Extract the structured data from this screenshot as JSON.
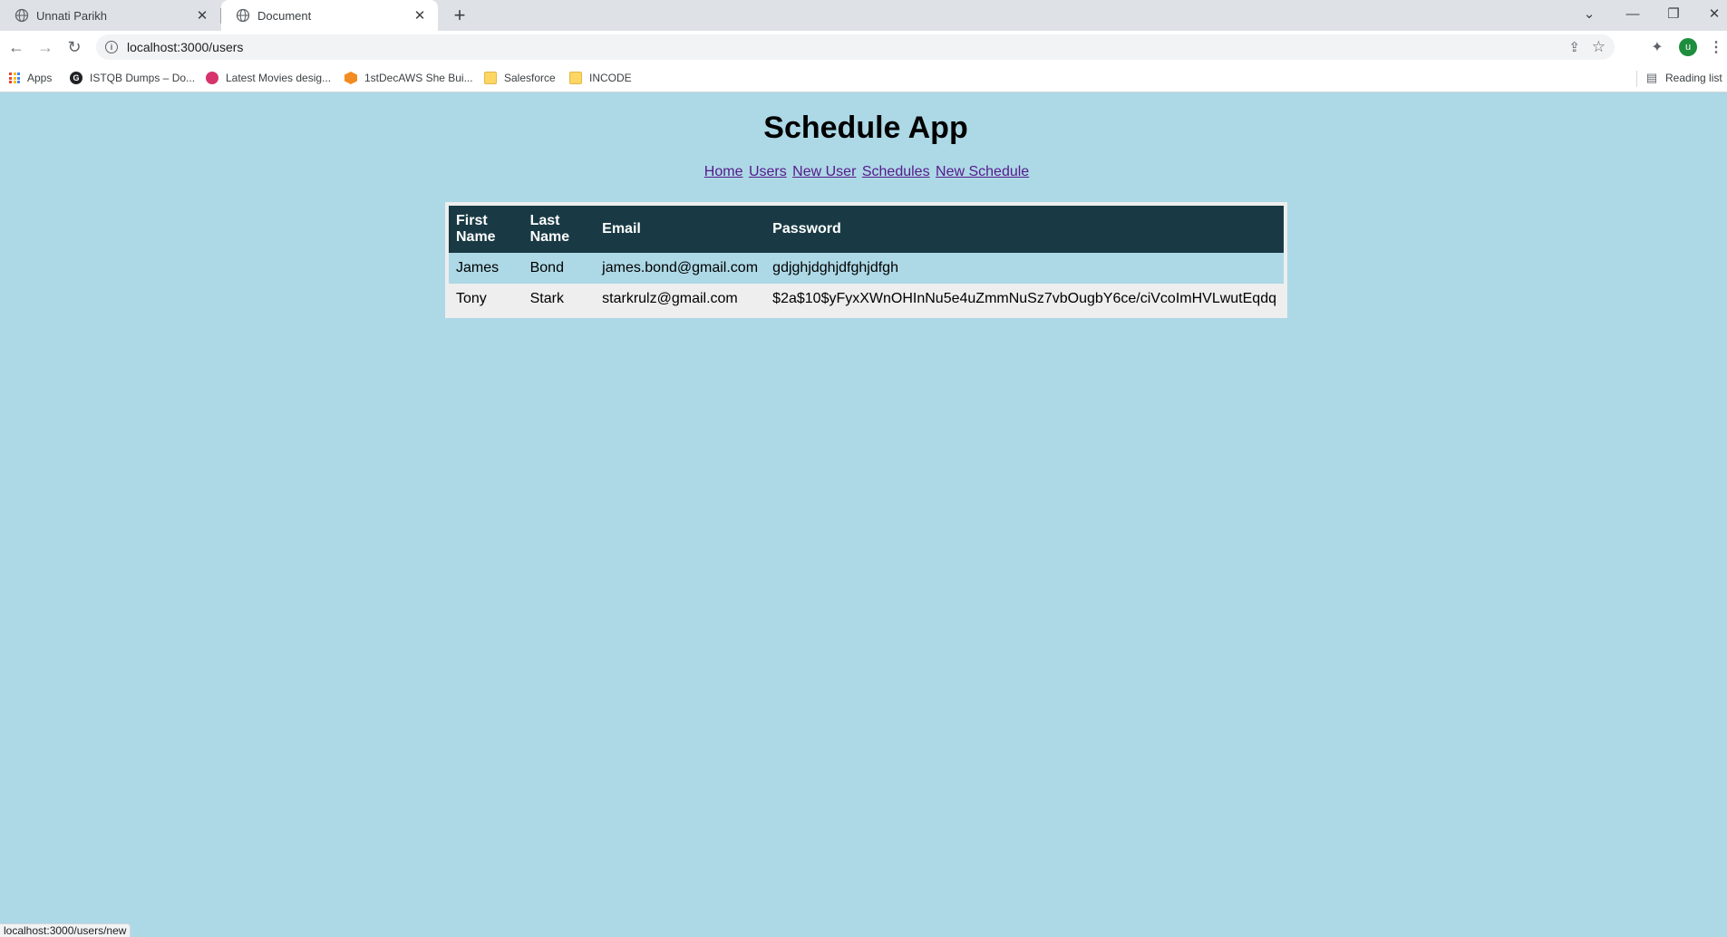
{
  "browser": {
    "tabs": [
      {
        "title": "Unnati Parikh",
        "active": false
      },
      {
        "title": "Document",
        "active": true
      }
    ],
    "new_tab_label": "+",
    "url": "localhost:3000/users",
    "bookmarks": [
      {
        "label": "Apps",
        "icon": "apps-grid-icon"
      },
      {
        "label": "ISTQB Dumps – Do...",
        "icon": "g-logo-icon"
      },
      {
        "label": "Latest Movies desig...",
        "icon": "dribbble-icon"
      },
      {
        "label": "1stDecAWS She Bui...",
        "icon": "aws-cube-icon"
      },
      {
        "label": "Salesforce",
        "icon": "folder-icon"
      },
      {
        "label": "INCODE",
        "icon": "folder-icon"
      }
    ],
    "reading_list_label": "Reading list",
    "avatar_initial": "u",
    "status_url": "localhost:3000/users/new"
  },
  "page": {
    "title": "Schedule App",
    "nav": [
      "Home",
      "Users",
      "New User",
      "Schedules",
      "New Schedule"
    ]
  },
  "users_table": {
    "headers": {
      "first_name": "First Name",
      "last_name": "Last Name",
      "email": "Email",
      "password": "Password"
    },
    "rows": [
      {
        "first_name": "James",
        "last_name": "Bond",
        "email": "james.bond@gmail.com",
        "password": "gdjghjdghjdfghjdfgh"
      },
      {
        "first_name": "Tony",
        "last_name": "Stark",
        "email": "starkrulz@gmail.com",
        "password": "$2a$10$yFyxXWnOHInNu5e4uZmmNuSz7vbOugbY6ce/ciVcoImHVLwutEqdq"
      }
    ]
  },
  "colors": {
    "page_background": "#add8e6",
    "table_header": "#193a44",
    "link": "#551a8b"
  }
}
